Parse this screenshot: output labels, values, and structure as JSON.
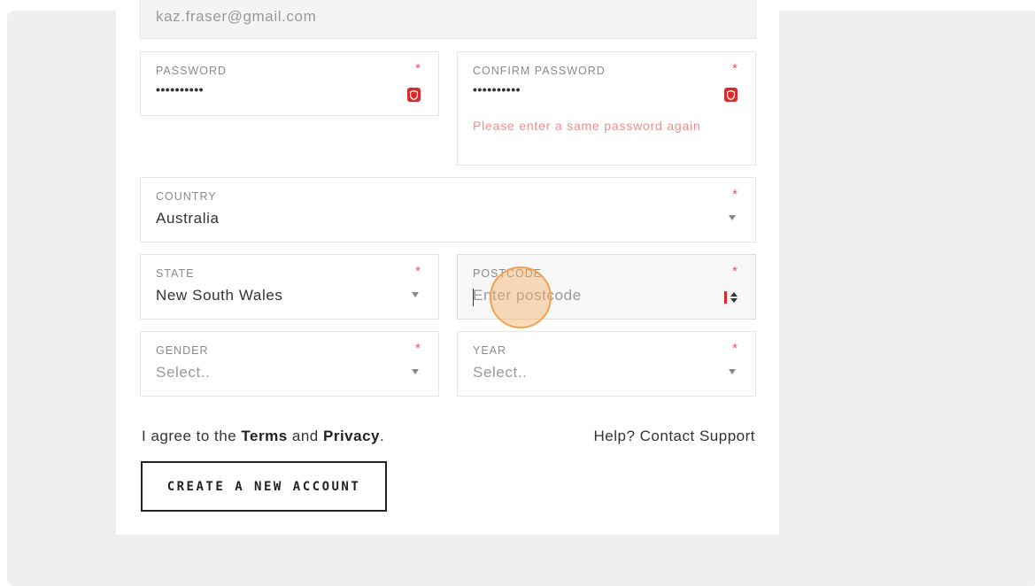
{
  "form": {
    "email": {
      "value": "kaz.fraser@gmail.com"
    },
    "password": {
      "label": "PASSWORD",
      "required_mark": "*",
      "value": "••••••••••",
      "icon": "shield-icon"
    },
    "confirm_password": {
      "label": "CONFIRM PASSWORD",
      "required_mark": "*",
      "value": "••••••••••",
      "icon": "shield-icon",
      "error": "Please enter a same password again"
    },
    "country": {
      "label": "COUNTRY",
      "required_mark": "*",
      "value": "Australia"
    },
    "state": {
      "label": "STATE",
      "required_mark": "*",
      "value": "New South Wales"
    },
    "postcode": {
      "label": "POSTCODE",
      "required_mark": "*",
      "placeholder": "Enter postcode"
    },
    "gender": {
      "label": "GENDER",
      "required_mark": "*",
      "placeholder": "Select.."
    },
    "year": {
      "label": "YEAR",
      "required_mark": "*",
      "placeholder": "Select.."
    }
  },
  "agreement": {
    "prefix": "I agree to the ",
    "terms": "Terms",
    "middle": " and ",
    "privacy": "Privacy",
    "suffix": "."
  },
  "help_link": "Help? Contact Support",
  "create_button": "CREATE A NEW ACCOUNT",
  "colors": {
    "required": "#e05a5a",
    "error": "#ef8f8f",
    "shield": "#d92b2b",
    "click_marker": "#f2a252"
  }
}
